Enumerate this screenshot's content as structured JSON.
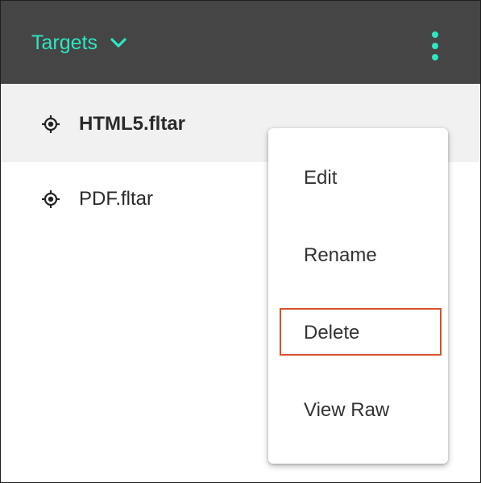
{
  "header": {
    "title": "Targets",
    "chevron_icon": "chevron-down-icon",
    "menu_icon": "more-vertical-icon",
    "accent_color": "#2ee6c1",
    "background_color": "#454545"
  },
  "targets": [
    {
      "label": "HTML5.fltar",
      "icon": "target-icon",
      "selected": true
    },
    {
      "label": "PDF.fltar",
      "icon": "target-icon",
      "selected": false
    }
  ],
  "context_menu": {
    "items": [
      {
        "label": "Edit"
      },
      {
        "label": "Rename"
      },
      {
        "label": "Delete",
        "highlighted": true
      },
      {
        "label": "View Raw"
      }
    ],
    "highlight_color": "#d9502a"
  }
}
